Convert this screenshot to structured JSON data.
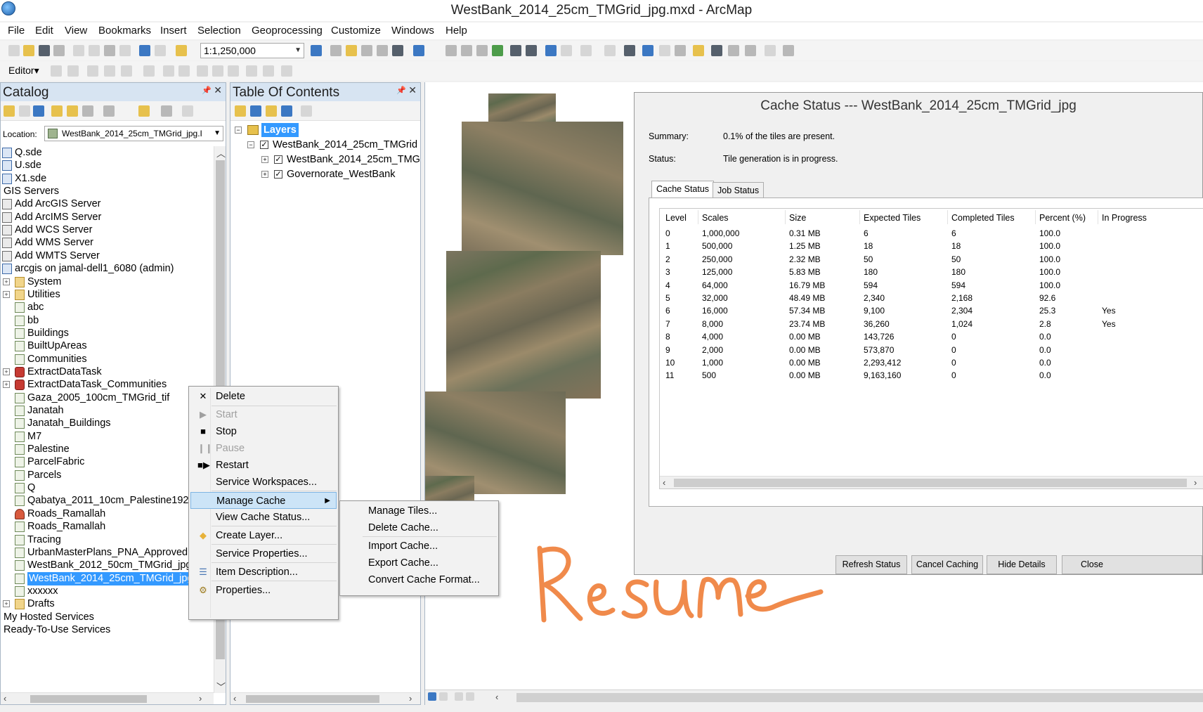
{
  "window": {
    "title": "WestBank_2014_25cm_TMGrid_jpg.mxd - ArcMap"
  },
  "menu": [
    "File",
    "Edit",
    "View",
    "Bookmarks",
    "Insert",
    "Selection",
    "Geoprocessing",
    "Customize",
    "Windows",
    "Help"
  ],
  "toolbar": {
    "scale_value": "1:1,250,000",
    "editor_label": "Editor▾"
  },
  "catalog": {
    "title": "Catalog",
    "location_label": "Location:",
    "location_value": "WestBank_2014_25cm_TMGrid_jpg.I",
    "items": [
      {
        "label": "Q.sde",
        "icon": "sde-connection-icon",
        "indent": 0,
        "expander": ""
      },
      {
        "label": "U.sde",
        "icon": "sde-connection-icon",
        "indent": 0,
        "expander": ""
      },
      {
        "label": "X1.sde",
        "icon": "sde-connection-icon",
        "indent": 0,
        "expander": ""
      },
      {
        "label": "GIS Servers",
        "icon": "",
        "indent": -1,
        "expander": ""
      },
      {
        "label": "Add ArcGIS Server",
        "icon": "add-server-icon",
        "indent": 0,
        "expander": ""
      },
      {
        "label": "Add ArcIMS Server",
        "icon": "add-server-icon",
        "indent": 0,
        "expander": ""
      },
      {
        "label": "Add WCS Server",
        "icon": "add-server-icon",
        "indent": 0,
        "expander": ""
      },
      {
        "label": "Add WMS Server",
        "icon": "add-server-icon",
        "indent": 0,
        "expander": ""
      },
      {
        "label": "Add WMTS Server",
        "icon": "add-server-icon",
        "indent": 0,
        "expander": ""
      },
      {
        "label": "arcgis on jamal-dell1_6080 (admin)",
        "icon": "server-connection-icon",
        "indent": 0,
        "expander": ""
      },
      {
        "label": "System",
        "icon": "folder-icon",
        "indent": 1,
        "expander": "+"
      },
      {
        "label": "Utilities",
        "icon": "folder-icon",
        "indent": 1,
        "expander": "+"
      },
      {
        "label": "abc",
        "icon": "map-service-icon",
        "indent": 1,
        "expander": ""
      },
      {
        "label": "bb",
        "icon": "map-service-icon",
        "indent": 1,
        "expander": ""
      },
      {
        "label": "Buildings",
        "icon": "map-service-icon",
        "indent": 1,
        "expander": ""
      },
      {
        "label": "BuiltUpAreas",
        "icon": "map-service-icon",
        "indent": 1,
        "expander": ""
      },
      {
        "label": "Communities",
        "icon": "map-service-icon",
        "indent": 1,
        "expander": ""
      },
      {
        "label": "ExtractDataTask",
        "icon": "gp-service-icon",
        "indent": 1,
        "expander": "+"
      },
      {
        "label": "ExtractDataTask_Communities",
        "icon": "gp-service-icon",
        "indent": 1,
        "expander": "+"
      },
      {
        "label": "Gaza_2005_100cm_TMGrid_tif",
        "icon": "map-service-icon",
        "indent": 1,
        "expander": ""
      },
      {
        "label": "Janatah",
        "icon": "map-service-icon",
        "indent": 1,
        "expander": ""
      },
      {
        "label": "Janatah_Buildings",
        "icon": "map-service-icon",
        "indent": 1,
        "expander": ""
      },
      {
        "label": "M7",
        "icon": "map-service-icon",
        "indent": 1,
        "expander": ""
      },
      {
        "label": "Palestine",
        "icon": "map-service-icon",
        "indent": 1,
        "expander": ""
      },
      {
        "label": "ParcelFabric",
        "icon": "map-service-icon",
        "indent": 1,
        "expander": ""
      },
      {
        "label": "Parcels",
        "icon": "map-service-icon",
        "indent": 1,
        "expander": ""
      },
      {
        "label": "Q",
        "icon": "map-service-icon",
        "indent": 1,
        "expander": ""
      },
      {
        "label": "Qabatya_2011_10cm_Palestine1923",
        "icon": "map-service-icon",
        "indent": 1,
        "expander": ""
      },
      {
        "label": "Roads_Ramallah",
        "icon": "feature-service-icon",
        "indent": 1,
        "expander": ""
      },
      {
        "label": "Roads_Ramallah",
        "icon": "map-service-icon",
        "indent": 1,
        "expander": ""
      },
      {
        "label": "Tracing",
        "icon": "map-service-icon",
        "indent": 1,
        "expander": ""
      },
      {
        "label": "UrbanMasterPlans_PNA_Approved",
        "icon": "map-service-icon",
        "indent": 1,
        "expander": ""
      },
      {
        "label": "WestBank_2012_50cm_TMGrid_jpg",
        "icon": "map-service-icon",
        "indent": 1,
        "expander": ""
      },
      {
        "label": "WestBank_2014_25cm_TMGrid_jpg",
        "icon": "map-service-icon",
        "indent": 1,
        "expander": "",
        "selected": true
      },
      {
        "label": "xxxxxx",
        "icon": "map-service-icon",
        "indent": 1,
        "expander": ""
      },
      {
        "label": "Drafts",
        "icon": "folder-icon",
        "indent": 1,
        "expander": "+"
      },
      {
        "label": "My Hosted Services",
        "icon": "",
        "indent": -1,
        "expander": ""
      },
      {
        "label": "Ready-To-Use Services",
        "icon": "",
        "indent": -1,
        "expander": ""
      }
    ]
  },
  "toc": {
    "title": "Table Of Contents",
    "root": "Layers",
    "items": [
      {
        "label": "WestBank_2014_25cm_TMGrid",
        "level": 1,
        "expander": "−",
        "checked": true
      },
      {
        "label": "WestBank_2014_25cm_TMG",
        "level": 2,
        "expander": "+",
        "checked": true
      },
      {
        "label": "Governorate_WestBank",
        "level": 2,
        "expander": "+",
        "checked": true
      }
    ]
  },
  "context_menu": {
    "items": [
      {
        "label": "Delete",
        "icon": "✕",
        "icon_name": "delete-icon",
        "disabled": false
      },
      {
        "label": "Start",
        "icon": "▶",
        "icon_name": "start-icon",
        "disabled": true
      },
      {
        "label": "Stop",
        "icon": "■",
        "icon_name": "stop-icon",
        "disabled": false
      },
      {
        "label": "Pause",
        "icon": "❙❙",
        "icon_name": "pause-icon",
        "disabled": true
      },
      {
        "label": "Restart",
        "icon": "■▶",
        "icon_name": "restart-icon",
        "disabled": false
      },
      {
        "label": "Service Workspaces...",
        "icon": "",
        "icon_name": "",
        "disabled": false
      },
      {
        "label": "Manage Cache",
        "icon": "",
        "icon_name": "",
        "disabled": false,
        "submenu": true,
        "hover": true
      },
      {
        "label": "View Cache Status...",
        "icon": "",
        "icon_name": "",
        "disabled": false
      },
      {
        "label": "Create Layer...",
        "icon": "◆",
        "icon_name": "layer-icon",
        "disabled": false
      },
      {
        "label": "Service Properties...",
        "icon": "",
        "icon_name": "",
        "disabled": false
      },
      {
        "label": "Item Description...",
        "icon": "☰",
        "icon_name": "description-icon",
        "disabled": false
      },
      {
        "label": "Properties...",
        "icon": "⚙",
        "icon_name": "properties-icon",
        "disabled": false
      }
    ]
  },
  "submenu": {
    "items": [
      "Manage Tiles...",
      "Delete Cache...",
      "Import Cache...",
      "Export Cache...",
      "Convert Cache Format..."
    ]
  },
  "cache_dialog": {
    "title": "Cache Status --- WestBank_2014_25cm_TMGrid_jpg",
    "summary_label": "Summary:",
    "summary_value": "0.1% of the tiles are present.",
    "status_label": "Status:",
    "status_value": "Tile generation is in progress.",
    "tabs": [
      "Cache Status",
      "Job Status"
    ],
    "columns": [
      "Level",
      "Scales",
      "Size",
      "Expected Tiles",
      "Completed Tiles",
      "Percent (%)",
      "In Progress"
    ],
    "rows": [
      [
        "0",
        "1,000,000",
        "0.31 MB",
        "6",
        "6",
        "100.0",
        ""
      ],
      [
        "1",
        "500,000",
        "1.25 MB",
        "18",
        "18",
        "100.0",
        ""
      ],
      [
        "2",
        "250,000",
        "2.32 MB",
        "50",
        "50",
        "100.0",
        ""
      ],
      [
        "3",
        "125,000",
        "5.83 MB",
        "180",
        "180",
        "100.0",
        ""
      ],
      [
        "4",
        "64,000",
        "16.79 MB",
        "594",
        "594",
        "100.0",
        ""
      ],
      [
        "5",
        "32,000",
        "48.49 MB",
        "2,340",
        "2,168",
        "92.6",
        ""
      ],
      [
        "6",
        "16,000",
        "57.34 MB",
        "9,100",
        "2,304",
        "25.3",
        "Yes"
      ],
      [
        "7",
        "8,000",
        "23.74 MB",
        "36,260",
        "1,024",
        "2.8",
        "Yes"
      ],
      [
        "8",
        "4,000",
        "0.00 MB",
        "143,726",
        "0",
        "0.0",
        ""
      ],
      [
        "9",
        "2,000",
        "0.00 MB",
        "573,870",
        "0",
        "0.0",
        ""
      ],
      [
        "10",
        "1,000",
        "0.00 MB",
        "2,293,412",
        "0",
        "0.0",
        ""
      ],
      [
        "11",
        "500",
        "0.00 MB",
        "9,163,160",
        "0",
        "0.0",
        ""
      ]
    ],
    "buttons": [
      "Refresh Status",
      "Cancel Caching",
      "Hide Details",
      "Close"
    ]
  },
  "annotation": {
    "text": "Resume",
    "color": "#f08a4b"
  }
}
